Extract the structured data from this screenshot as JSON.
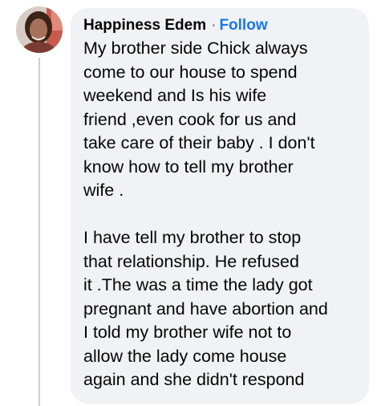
{
  "comment": {
    "author": "Happiness Edem",
    "separator": "·",
    "follow_label": "Follow",
    "avatar_icon": "profile-photo",
    "paragraphs": [
      [
        "My brother side Chick always",
        "come to our house to spend",
        "weekend and Is his wife",
        "friend ,even cook for us and",
        "take care of their baby . I don't",
        "know how to tell my brother",
        "wife ."
      ],
      [
        "I have tell my brother to stop",
        "that relationship. He refused",
        "it .The was a time the lady got",
        "pregnant and have abortion and",
        "I told my brother wife not to",
        "allow the lady come house",
        "again and she didn't respond"
      ]
    ]
  },
  "colors": {
    "bubble_bg": "#f0f2f5",
    "follow_link": "#1877f2",
    "text": "#050505",
    "thread_line": "#ced0d4"
  }
}
